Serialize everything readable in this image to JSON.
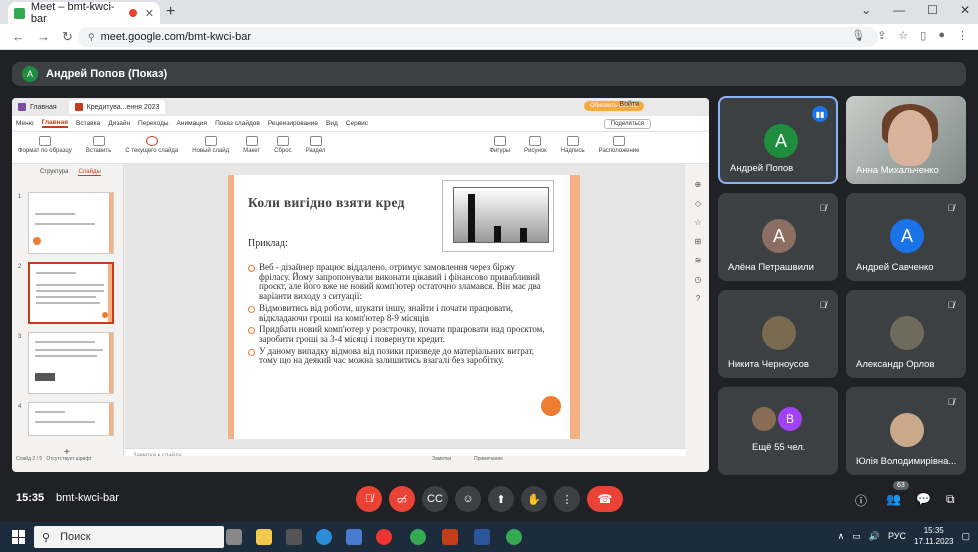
{
  "browser": {
    "tab_title": "Meet – bmt-kwci-bar",
    "tab_close": "✕",
    "new_tab": "+",
    "url": "meet.google.com/bmt-kwci-bar",
    "win_min": "—",
    "win_max": "☐",
    "win_close": "✕",
    "win_chevron": "⌄"
  },
  "presenter_bar": {
    "avatar_letter": "A",
    "label": "Андрей Попов (Показ)"
  },
  "ppt": {
    "tabs": [
      "Главная",
      "Кредитува...ення 2023"
    ],
    "signin": "Войти",
    "update_button": "Обновить сейчас",
    "share_button": "Поделиться",
    "menu": [
      "Меню",
      "Главная",
      "Вставка",
      "Дизайн",
      "Переходы",
      "Анимация",
      "Показ слайдов",
      "Рецензирование",
      "Вид",
      "Сервис"
    ],
    "ribbon": [
      "Формат по образцу",
      "Вставить",
      "С текущего слайда",
      "Новый слайд",
      "Макет",
      "Сброс",
      "Раздел",
      "Фигуры",
      "Рисунок",
      "Надпись",
      "Расположение"
    ],
    "side_tabs": [
      "Структура",
      "Слайды"
    ],
    "thumbs": [
      "1",
      "2",
      "3",
      "4"
    ],
    "notes_placeholder": "Заметки к слайду",
    "status_left": "Слайд 2 / 5",
    "status_mid": "Отсутствует шрифт",
    "status_right": "Заметки",
    "status_right2": "Примечание"
  },
  "slide": {
    "title": "Коли вигідно взяти кред",
    "subtitle": "Приклад:",
    "bullets": [
      "Веб - дізайнер  працює віддалено, отримує замовлення через біржу фріласу. Йому запропонували виконати цікавий і фінансово привабливий проєкт, але його вже не новий комп'ютер остаточно зламався. Він має два варіанти виходу з ситуації:",
      "Відмовитись від роботи, шукати іншу, знайти і почати працювати, відкладаючи гроші на комп'ютер 8-9 місяців",
      "Придбати новий комп'ютер у розстрочку, почати працювати над проєктом, заробити гроші за 3-4 місяці і повернути кредит.",
      "У даному випадку відмова від позики призведе до матеріальних витрат, тому що на деякий час можна залишитись взагалі без заробітку."
    ]
  },
  "participants": [
    {
      "name": "Андрей Попов",
      "letter": "A",
      "color": "#1e8e3e",
      "state": "speaking"
    },
    {
      "name": "Анна Михальченко",
      "letter": "",
      "color": "",
      "state": "video"
    },
    {
      "name": "Алёна Петрашвили",
      "letter": "A",
      "color": "#8d6e63",
      "state": "muted"
    },
    {
      "name": "Андрей Савченко",
      "letter": "A",
      "color": "#1a73e8",
      "state": "muted"
    },
    {
      "name": "Никита Черноусов",
      "letter": "",
      "color": "#7a6a4f",
      "state": "muted"
    },
    {
      "name": "Александр Орлов",
      "letter": "",
      "color": "#6f6a5c",
      "state": "muted"
    },
    {
      "name": "Ещё 55 чел.",
      "letter": "B",
      "color": "#a142f4",
      "state": "more"
    },
    {
      "name": "Юлія Володимирівна...",
      "letter": "",
      "color": "#c9a98a",
      "state": "muted"
    }
  ],
  "controls": {
    "time": "15:35",
    "meeting_code": "bmt-kwci-bar",
    "people_count": "63"
  },
  "taskbar": {
    "search": "Поиск",
    "lang": "РУС",
    "time": "15:35",
    "date": "17.11.2023"
  }
}
